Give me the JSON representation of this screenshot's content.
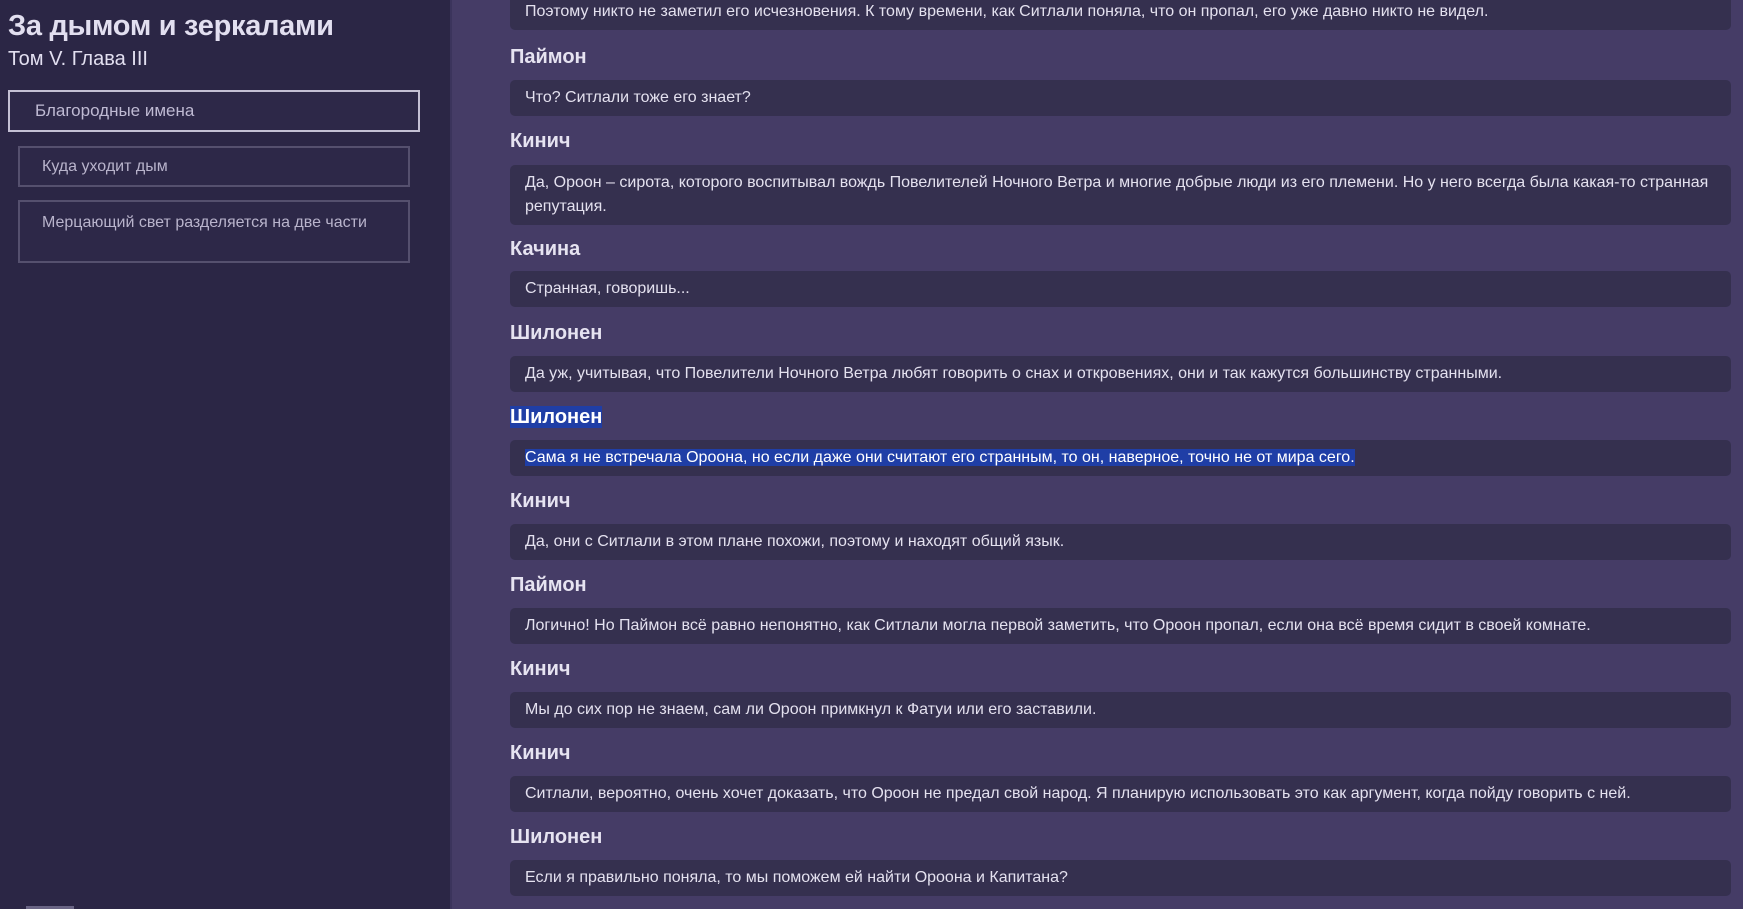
{
  "sidebar": {
    "title": "За дымом и зеркалами",
    "subtitle": "Том V. Глава III",
    "items": [
      {
        "label": "Благородные имена"
      },
      {
        "label": "Куда уходит дым"
      },
      {
        "label": "Мерцающий свет разделяется на две части"
      }
    ]
  },
  "dialogue": [
    {
      "text": "Поэтому никто не заметил его исчезновения. К тому времени, как Ситлали поняла, что он пропал, его уже давно никто не видел."
    },
    {
      "speaker": "Паймон",
      "text": "Что? Ситлали тоже его знает?"
    },
    {
      "speaker": "Кинич",
      "text": "Да, Ороон – сирота, которого воспитывал вождь Повелителей Ночного Ветра и многие добрые люди из его племени. Но у него всегда была какая-то странная репутация."
    },
    {
      "speaker": "Качина",
      "text": "Странная, говоришь..."
    },
    {
      "speaker": "Шилонен",
      "text": "Да уж, учитывая, что Повелители Ночного Ветра любят говорить о снах и откровениях, они и так кажутся большинству странными."
    },
    {
      "speaker": "Шилонен",
      "text": "Сама я не встречала Ороона, но если даже они считают его странным, то он, наверное, точно не от мира сего."
    },
    {
      "speaker": "Кинич",
      "text": "Да, они с Ситлали в этом плане похожи, поэтому и находят общий язык."
    },
    {
      "speaker": "Паймон",
      "text": "Логично! Но Паймон всё равно непонятно, как Ситлали могла первой заметить, что Ороон пропал, если она всё время сидит в своей комнате."
    },
    {
      "speaker": "Кинич",
      "text": "Мы до сих пор не знаем, сам ли Ороон примкнул к Фатуи или его заставили."
    },
    {
      "speaker": "Кинич",
      "text": "Ситлали, вероятно, очень хочет доказать, что Ороон не предал свой народ. Я планирую использовать это как аргумент, когда пойду говорить с ней."
    },
    {
      "speaker": "Шилонен",
      "text": "Если я правильно поняла, то мы поможем ей найти Ороона и Капитана?"
    }
  ],
  "colors": {
    "background": "#453c66",
    "sidebar": "#2b2645",
    "line_box": "#35304f",
    "selection": "#1f3ea6"
  }
}
